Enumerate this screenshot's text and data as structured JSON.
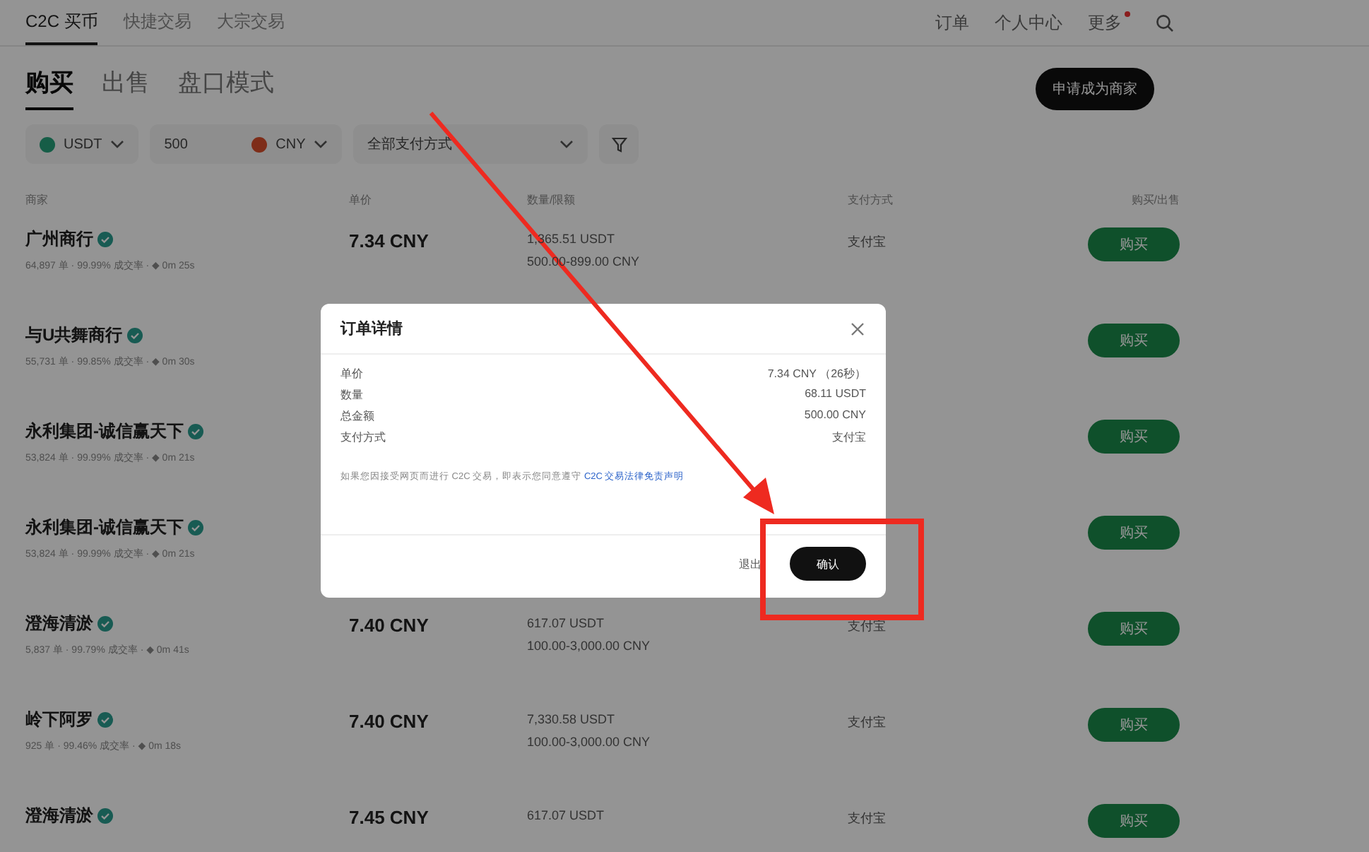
{
  "top_nav": {
    "links": [
      {
        "label": "C2C 买币",
        "selected": true
      },
      {
        "label": "快捷交易",
        "selected": false
      },
      {
        "label": "大宗交易",
        "selected": false
      }
    ],
    "right_links": [
      "订单",
      "个人中心",
      "更多"
    ]
  },
  "tabs": [
    {
      "label": "购买",
      "selected": true
    },
    {
      "label": "出售",
      "selected": false
    },
    {
      "label": "盘口模式",
      "selected": false
    }
  ],
  "merchant_button": "申请成为商家",
  "filters": {
    "crypto": "USDT",
    "amount": "500",
    "fiat": "CNY",
    "payment": "全部支付方式"
  },
  "table": {
    "columns": [
      "商家",
      "单价",
      "数量/限额",
      "支付方式",
      "购买/出售"
    ],
    "rows": [
      {
        "merchant": "广州商行",
        "stats": "64,897 单 · 99.99% 成交率 · ◆ 0m 25s",
        "price": "7.34 CNY",
        "quantity": "1,365.51 USDT",
        "limit": "500.00-899.00 CNY",
        "payment": "支付宝",
        "action": "购买"
      },
      {
        "merchant": "与U共舞商行",
        "stats": "55,731 单 · 99.85% 成交率 · ◆ 0m 30s",
        "action": "购买"
      },
      {
        "merchant": "永利集团-诚信赢天下",
        "stats": "53,824 单 · 99.99% 成交率 · ◆ 0m 21s",
        "action": "购买"
      },
      {
        "merchant": "永利集团-诚信赢天下",
        "stats": "53,824 单 · 99.99% 成交率 · ◆ 0m 21s",
        "action": "购买"
      },
      {
        "merchant": "澄海清淤",
        "stats": "5,837 单 · 99.79% 成交率 · ◆ 0m 41s",
        "price": "7.40 CNY",
        "quantity": "617.07 USDT",
        "limit": "100.00-3,000.00 CNY",
        "payment": "支付宝",
        "action": "购买"
      },
      {
        "merchant": "岭下阿罗",
        "stats": "925 单 · 99.46% 成交率 · ◆ 0m 18s",
        "price": "7.40 CNY",
        "quantity": "7,330.58 USDT",
        "limit": "100.00-3,000.00 CNY",
        "payment": "支付宝",
        "action": "购买"
      },
      {
        "merchant": "澄海清淤",
        "price": "7.45 CNY",
        "quantity": "617.07 USDT",
        "payment": "支付宝",
        "action": "购买"
      }
    ]
  },
  "dialog": {
    "title": "订单详情",
    "details": [
      {
        "label": "单价",
        "value": "7.34 CNY （26秒）"
      },
      {
        "label": "数量",
        "value": "68.11 USDT"
      },
      {
        "label": "总金额",
        "value": "500.00 CNY"
      },
      {
        "label": "支付方式",
        "value": "支付宝"
      }
    ],
    "note": "如果您因接受网页而进行 C2C 交易，即表示您同意遵守",
    "note_link": "C2C 交易法律免责声明",
    "cancel": "退出",
    "confirm": "确认"
  }
}
